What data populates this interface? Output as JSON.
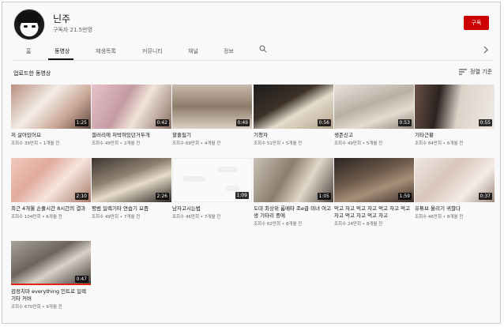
{
  "channel": {
    "name": "닌주",
    "subscribers": "구독자 21.5만명",
    "subscribe_label": "구독"
  },
  "tabs": [
    {
      "label": "홈"
    },
    {
      "label": "동영상"
    },
    {
      "label": "재생목록"
    },
    {
      "label": "커뮤니티"
    },
    {
      "label": "채널"
    },
    {
      "label": "정보"
    }
  ],
  "section": {
    "title": "업로드한 동영상",
    "sort_label": "정렬 기준"
  },
  "videos": [
    {
      "title": "저 살아있어요",
      "views": "조회수 39만회",
      "age": "1개월 전",
      "duration": "1:25"
    },
    {
      "title": "갤러리에 처박혀있던거두개",
      "views": "조회수 49만회",
      "age": "2개월 전",
      "duration": "0:42"
    },
    {
      "title": "할줄필기",
      "views": "조회수 69만회",
      "age": "4개월 전",
      "duration": "0:49"
    },
    {
      "title": "기청자",
      "views": "조회수 51만회",
      "age": "5개월 전",
      "duration": "0:56"
    },
    {
      "title": "생존신고",
      "views": "조회수 49만회",
      "age": "5개월 전",
      "duration": "0:53"
    },
    {
      "title": "기타근황",
      "views": "조회수 84만회",
      "age": "6개월 전",
      "duration": "0:55"
    },
    {
      "title": "최근 4개월 손풀시간 8시간의 결과",
      "views": "조회수 104만회",
      "age": "6개월 전",
      "duration": "2:10"
    },
    {
      "title": "평범 일렉기타 연습기 요즘",
      "views": "조회수 49만회",
      "age": "7개월 전",
      "duration": "2:26"
    },
    {
      "title": "남자고시는법",
      "views": "조회수 46만회",
      "age": "7개월 전",
      "duration": "1:09"
    },
    {
      "title": "도대 최상위 룸메타 조e곱 미녀 여고생 기타리 중에",
      "views": "조회수 62만회",
      "age": "8개월 전",
      "duration": "1:05"
    },
    {
      "title": "먹고 자고 먹고 자고 먹고 자고 먹고 자고 먹고 자고 먹고 자고",
      "views": "조회수 24만회",
      "age": "8개월 전",
      "duration": "1:59"
    },
    {
      "title": "유튜브 올리기 귀찮다",
      "views": "조회수 46만회",
      "age": "8개월 전",
      "duration": "0:37"
    },
    {
      "title": "검정치마 everything 인트로 일렉기타 커버",
      "views": "조회수 670만회",
      "age": "9개월 전",
      "duration": "0:47"
    }
  ],
  "icons": {
    "search": "search-icon",
    "chevron": "chevron-right-icon",
    "sort": "sort-icon"
  },
  "colors": {
    "subscribe": "#cc0000",
    "progress": "#e62117"
  }
}
